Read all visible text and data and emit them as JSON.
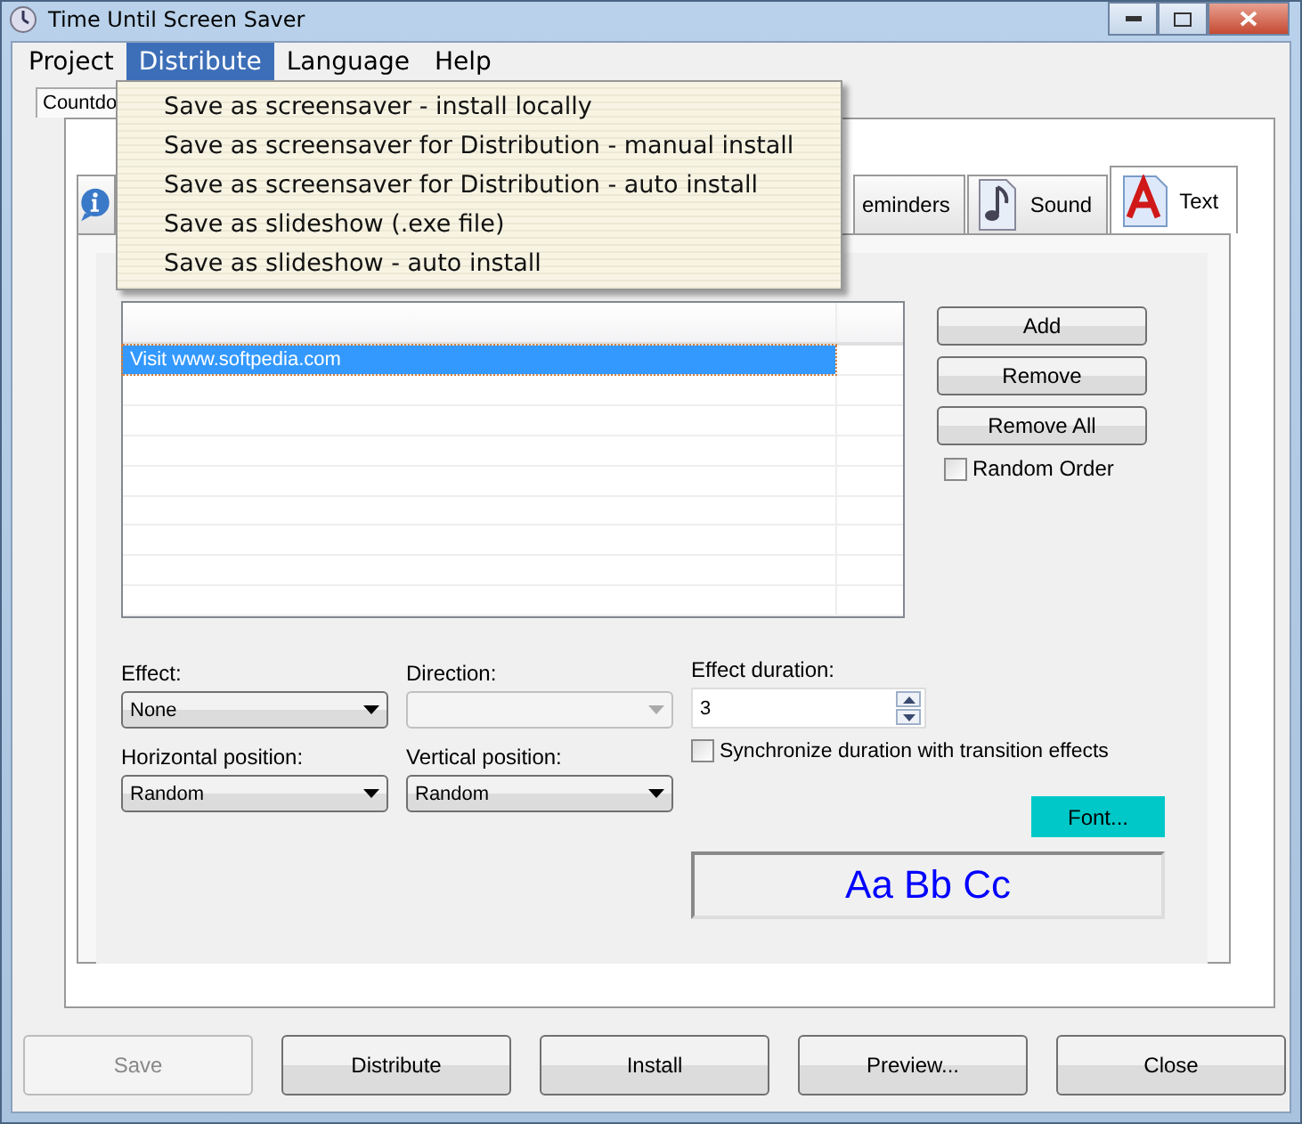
{
  "window": {
    "title": "Time Until Screen Saver"
  },
  "menu_bar": [
    {
      "label": "Project",
      "selected": false
    },
    {
      "label": "Distribute",
      "selected": true
    },
    {
      "label": "Language",
      "selected": false
    },
    {
      "label": "Help",
      "selected": false
    }
  ],
  "dropdown": [
    "Save as screensaver - install locally",
    "Save as screensaver for Distribution - manual install",
    "Save as screensaver for Distribution - auto install",
    "Save as slideshow (.exe file)",
    "Save as slideshow - auto install"
  ],
  "outer_tabs": [
    {
      "label": "Countdo",
      "selected": true
    }
  ],
  "tabs": [
    {
      "kind": "info",
      "selected": false
    },
    {
      "kind": "plain",
      "label": "eminders",
      "selected": false
    },
    {
      "kind": "note",
      "label": "Sound",
      "selected": false
    },
    {
      "kind": "letter",
      "label": "Text",
      "selected": true
    }
  ],
  "messages": [
    {
      "text": "Visit www.softpedia.com",
      "selected": true
    }
  ],
  "list_buttons": [
    "Add",
    "Remove",
    "Remove All"
  ],
  "random_order": {
    "label": "Random Order",
    "checked": false
  },
  "effect": {
    "label": "Effect:",
    "value": "None"
  },
  "direction": {
    "label": "Direction:",
    "disabled": true
  },
  "horizontal": {
    "label": "Horizontal position:",
    "value": "Random"
  },
  "vertical": {
    "label": "Vertical position:",
    "value": "Random"
  },
  "duration": {
    "label": "Effect duration:",
    "value": "3"
  },
  "sync": {
    "label": "Synchronize duration with transition effects",
    "checked": false
  },
  "font_button": "Font...",
  "font_preview": "Aa Bb Cc",
  "buttons": [
    {
      "label": "Save",
      "disabled": true
    },
    {
      "label": "Distribute",
      "disabled": false
    },
    {
      "label": "Install",
      "disabled": false
    },
    {
      "label": "Preview...",
      "disabled": false
    },
    {
      "label": "Close",
      "disabled": false
    }
  ]
}
